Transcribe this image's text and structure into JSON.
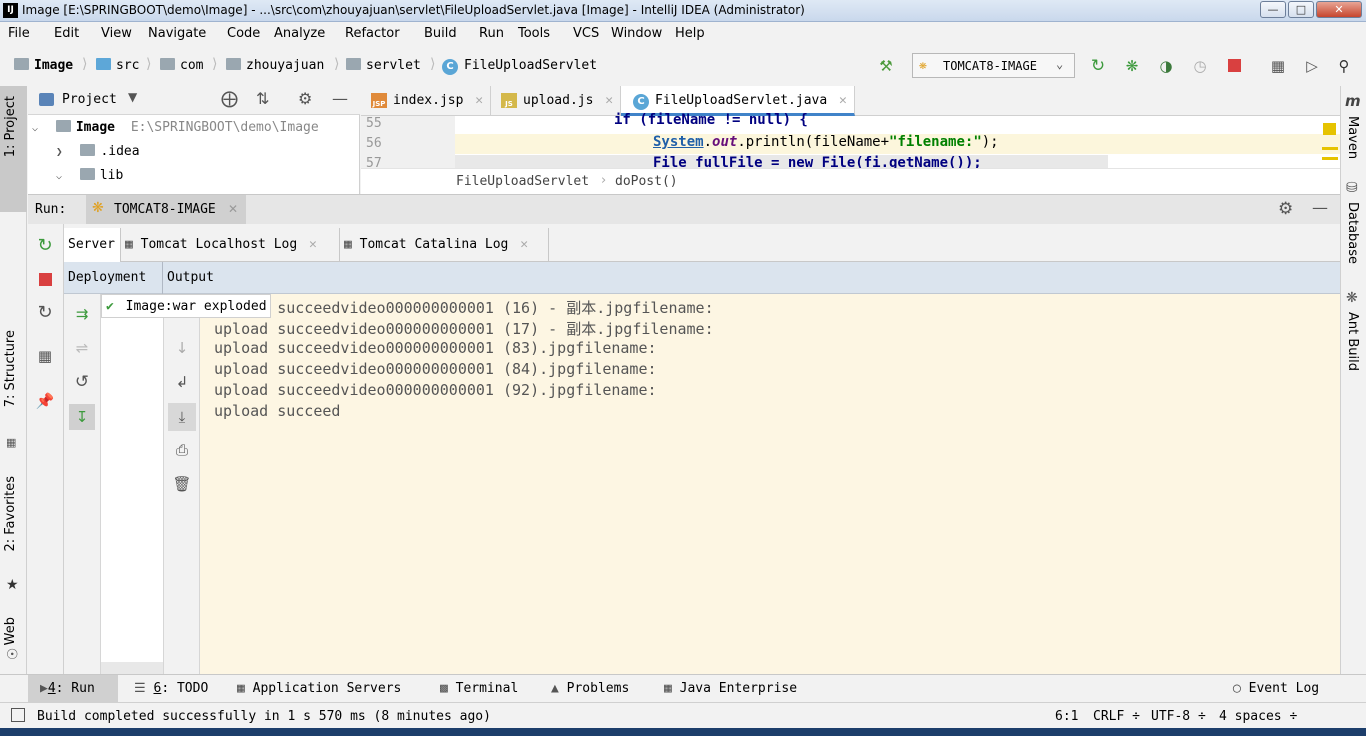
{
  "window": {
    "title": "Image [E:\\SPRINGBOOT\\demo\\Image] - ...\\src\\com\\zhouyajuan\\servlet\\FileUploadServlet.java [Image] - IntelliJ IDEA (Administrator)",
    "app_icon": "IJ"
  },
  "menu": [
    "File",
    "Edit",
    "View",
    "Navigate",
    "Code",
    "Analyze",
    "Refactor",
    "Build",
    "Run",
    "Tools",
    "VCS",
    "Window",
    "Help"
  ],
  "breadcrumbs": [
    "Image",
    "src",
    "com",
    "zhouyajuan",
    "servlet",
    "FileUploadServlet"
  ],
  "run_config": "TOMCAT8-IMAGE",
  "left_tabs": {
    "project": "1: Project",
    "structure": "7: Structure",
    "favorites": "2: Favorites",
    "web": "Web"
  },
  "right_tabs": [
    "Maven",
    "Database",
    "Ant Build"
  ],
  "project_panel": {
    "title": "Project",
    "tree": [
      {
        "label": "Image",
        "path": "E:\\SPRINGBOOT\\demo\\Image"
      },
      {
        "label": ".idea"
      },
      {
        "label": "lib"
      }
    ]
  },
  "editor": {
    "tabs": [
      {
        "label": "index.jsp",
        "icon": "JSP"
      },
      {
        "label": "upload.js",
        "icon": "JS"
      },
      {
        "label": "FileUploadServlet.java",
        "icon": "C"
      }
    ],
    "lines": [
      {
        "num": "55",
        "text": "if (fileName != null) {"
      },
      {
        "num": "56",
        "cls": "System",
        "field": "out",
        "method": ".println(fileName+",
        "str": "\"filename:\"",
        "end": ");"
      },
      {
        "num": "57",
        "text": "File fullFile = new File(fi.getName());"
      }
    ],
    "breadcrumb": [
      "FileUploadServlet",
      "doPost()"
    ]
  },
  "run": {
    "label": "Run:",
    "config_tab": "TOMCAT8-IMAGE",
    "tabs": [
      "Server",
      "Tomcat Localhost Log",
      "Tomcat Catalina Log"
    ],
    "columns": [
      "Deployment",
      "Output"
    ],
    "deployment_item": "Image:war exploded",
    "output_lines": [
      "upload succeedvideo000000000001 (16) - 副本.jpgfilename:",
      "upload succeedvideo000000000001 (17) - 副本.jpgfilename:",
      "upload succeedvideo000000000001 (83).jpgfilename:",
      "upload succeedvideo000000000001 (84).jpgfilename:",
      "upload succeedvideo000000000001 (92).jpgfilename:",
      "upload succeed"
    ]
  },
  "bottom_tabs": [
    {
      "num": "4",
      "label": ": Run"
    },
    {
      "num": "6",
      "label": ": TODO"
    },
    {
      "label": "Application Servers"
    },
    {
      "label": "Terminal"
    },
    {
      "label": "Problems"
    },
    {
      "label": "Java Enterprise"
    }
  ],
  "event_log": "Event Log",
  "status": {
    "message": "Build completed successfully in 1 s 570 ms (8 minutes ago)",
    "position": "6:1",
    "line_sep": "CRLF ÷",
    "encoding": "UTF-8 ÷",
    "indent": "4 spaces ÷"
  },
  "colors": {
    "accent": "#4083c9",
    "output_bg": "#fdf6e3",
    "run_green": "#3c9a3c",
    "stop_red": "#d94040"
  }
}
